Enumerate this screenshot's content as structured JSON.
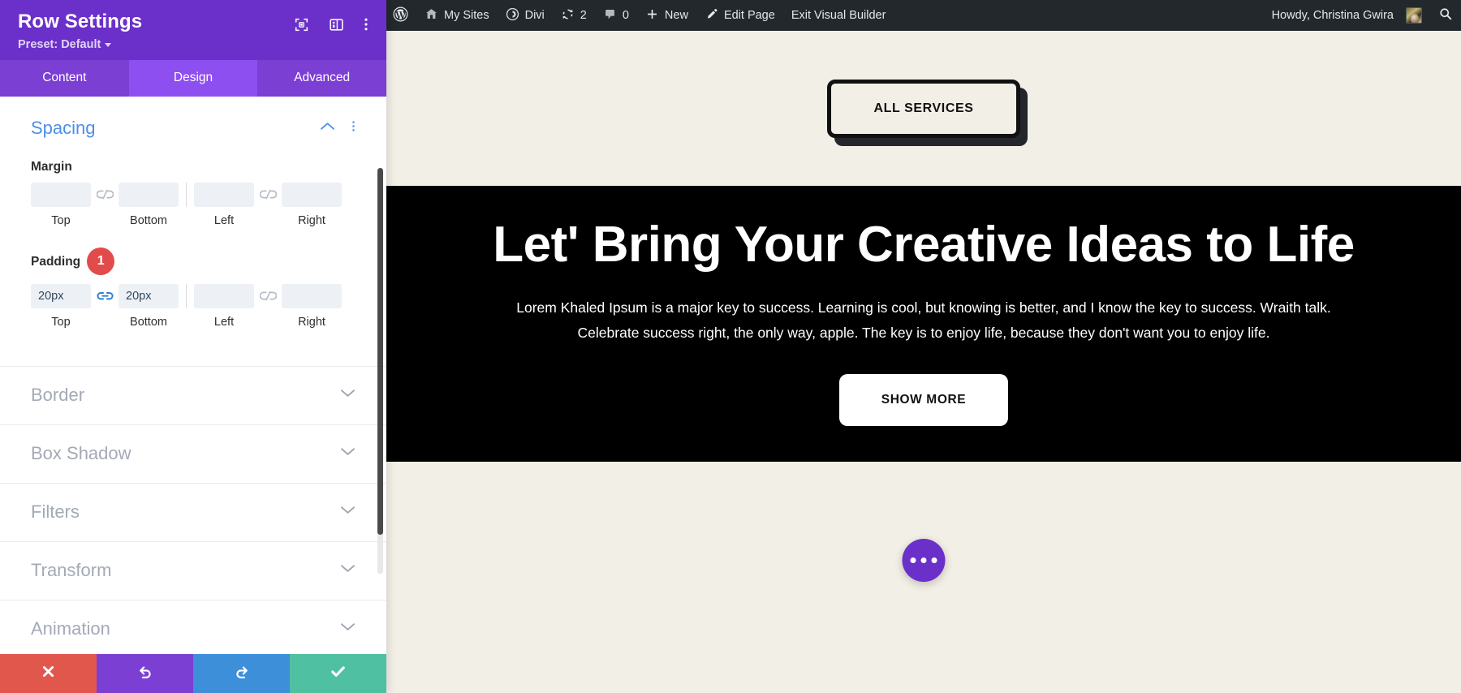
{
  "settings_panel": {
    "title": "Row Settings",
    "preset_label": "Preset: Default",
    "header_icons": [
      {
        "name": "responsive-preview-icon"
      },
      {
        "name": "layout-columns-icon"
      },
      {
        "name": "more-vertical-icon"
      }
    ],
    "tabs": [
      {
        "label": "Content",
        "active": false
      },
      {
        "label": "Design",
        "active": true
      },
      {
        "label": "Advanced",
        "active": false
      }
    ],
    "spacing": {
      "section_title": "Spacing",
      "margin": {
        "label": "Margin",
        "fields": [
          {
            "caption": "Top",
            "value": "",
            "placeholder": ""
          },
          {
            "caption": "Bottom",
            "value": "",
            "placeholder": ""
          },
          {
            "caption": "Left",
            "value": "",
            "placeholder": ""
          },
          {
            "caption": "Right",
            "value": "",
            "placeholder": ""
          }
        ],
        "link_left_linked": false,
        "link_right_linked": false
      },
      "padding": {
        "label": "Padding",
        "badge": "1",
        "fields": [
          {
            "caption": "Top",
            "value": "20px",
            "placeholder": ""
          },
          {
            "caption": "Bottom",
            "value": "20px",
            "placeholder": ""
          },
          {
            "caption": "Left",
            "value": "",
            "placeholder": ""
          },
          {
            "caption": "Right",
            "value": "",
            "placeholder": ""
          }
        ],
        "link_left_linked": true,
        "link_right_linked": false
      }
    },
    "accordions": [
      {
        "label": "Border"
      },
      {
        "label": "Box Shadow"
      },
      {
        "label": "Filters"
      },
      {
        "label": "Transform"
      },
      {
        "label": "Animation"
      }
    ],
    "footer_buttons": [
      {
        "name": "cancel-button",
        "icon": "close-icon",
        "color": "#e2574c"
      },
      {
        "name": "undo-button",
        "icon": "undo-icon",
        "color": "#7b3fd4"
      },
      {
        "name": "redo-button",
        "icon": "redo-icon",
        "color": "#3c8fd8"
      },
      {
        "name": "save-button",
        "icon": "check-icon",
        "color": "#4fc0a1"
      }
    ],
    "colors": {
      "header_purple": "#6b30c9",
      "tab_purple": "#7b3fd4",
      "tab_active_purple": "#8e4ff0",
      "section_blue": "#4c8fe8",
      "badge_red": "#e24b4b"
    }
  },
  "adminbar": {
    "left_items": [
      {
        "label": "",
        "icon": "wordpress-logo-icon"
      },
      {
        "label": "My Sites",
        "icon": "sites-icon"
      },
      {
        "label": "Divi",
        "icon": "divi-icon"
      },
      {
        "label": "2",
        "icon": "updates-icon"
      },
      {
        "label": "0",
        "icon": "comments-icon"
      },
      {
        "label": "New",
        "icon": "plus-icon"
      },
      {
        "label": "Edit Page",
        "icon": "pencil-icon"
      },
      {
        "label": "Exit Visual Builder",
        "icon": ""
      }
    ],
    "howdy": "Howdy, Christina Gwira",
    "avatar": "user-avatar",
    "search": "search-icon"
  },
  "page": {
    "all_services_button": "ALL SERVICES",
    "heading": "Let' Bring Your Creative Ideas to Life",
    "paragraph": "Lorem Khaled Ipsum is a major key to success. Learning is cool, but knowing is better, and I know the key to success. Wraith talk. Celebrate success right, the only way, apple. The key is to enjoy life, because they don't want you to enjoy life.",
    "show_more_button": "SHOW MORE",
    "fab": "more-options-fab",
    "colors": {
      "cream": "#f2efe6",
      "black": "#000000",
      "fab_purple": "#6b30c9"
    }
  }
}
